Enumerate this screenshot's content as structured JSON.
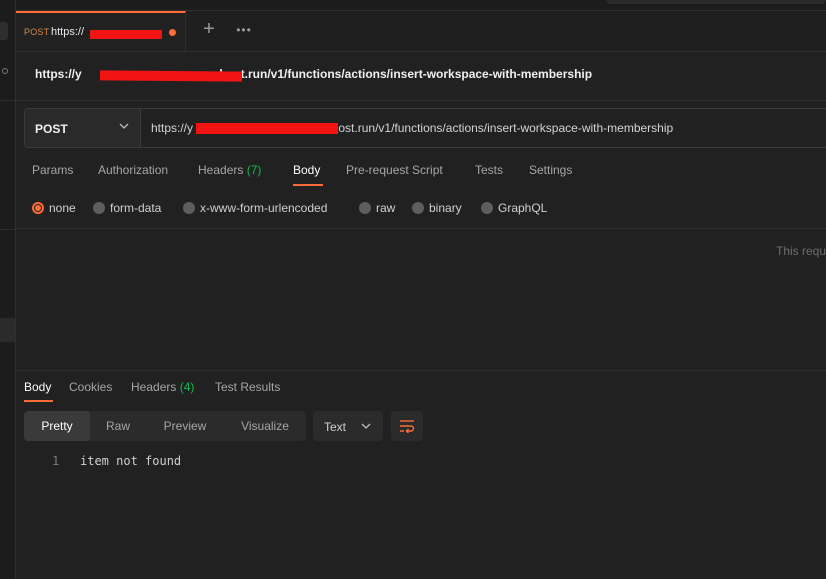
{
  "tab": {
    "method": "POST",
    "url_prefix": "https://"
  },
  "request": {
    "name": "https://y nhost.run/v1/functions/actions/insert-workspace-with-membership",
    "name_prefix": "https://y",
    "name_suffix": ".nhost.run/v1/functions/actions/insert-workspace-with-membership",
    "method": "POST",
    "url_prefix": "https://y",
    "url_suffix": "nhost.run/v1/functions/actions/insert-workspace-with-membership"
  },
  "request_tabs": [
    {
      "label": "Params"
    },
    {
      "label": "Authorization"
    },
    {
      "label": "Headers",
      "count": "(7)"
    },
    {
      "label": "Body",
      "active": true
    },
    {
      "label": "Pre-request Script"
    },
    {
      "label": "Tests"
    },
    {
      "label": "Settings"
    }
  ],
  "body_types": [
    {
      "label": "none",
      "selected": true
    },
    {
      "label": "form-data"
    },
    {
      "label": "x-www-form-urlencoded"
    },
    {
      "label": "raw"
    },
    {
      "label": "binary"
    },
    {
      "label": "GraphQL"
    }
  ],
  "body_hint": "This requ",
  "response": {
    "tabs": [
      {
        "label": "Body",
        "active": true
      },
      {
        "label": "Cookies"
      },
      {
        "label": "Headers",
        "count": "(4)"
      },
      {
        "label": "Test Results"
      }
    ],
    "views": [
      {
        "label": "Pretty",
        "active": true
      },
      {
        "label": "Raw"
      },
      {
        "label": "Preview"
      },
      {
        "label": "Visualize"
      }
    ],
    "format": "Text",
    "lines": [
      {
        "number": "1",
        "text": "item not found"
      }
    ]
  },
  "colors": {
    "accent": "#ff6c37",
    "count_green": "#0cbb52",
    "redaction": "#f21313",
    "background": "#212121"
  }
}
